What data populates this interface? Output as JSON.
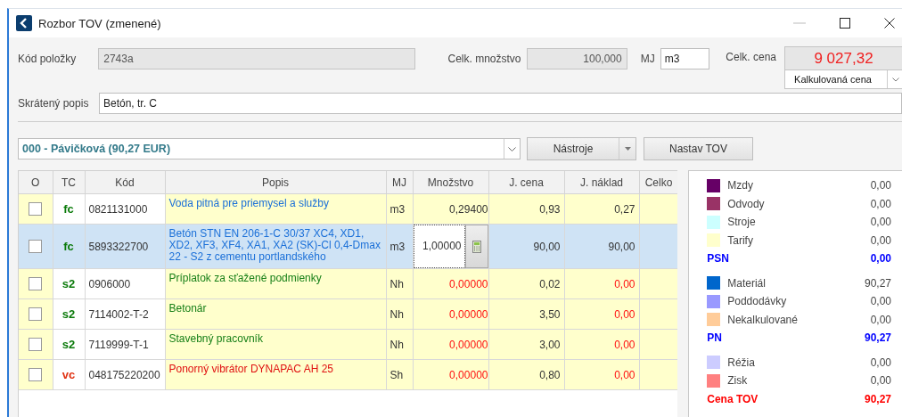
{
  "window": {
    "title": "Rozbor TOV (zmenené)"
  },
  "header": {
    "code_label": "Kód položky",
    "code_value": "2743a",
    "qty_label": "Celk. množstvo",
    "qty_value": "100,000",
    "unit_label": "MJ",
    "unit_value": "m3",
    "price_label": "Celk. cena",
    "price_value": "9 027,32",
    "price_type": "Kalkulovaná cena",
    "short_label": "Skrátený popis",
    "short_value": "Betón, tr. C"
  },
  "toolbar": {
    "combo": "000 - Pávičková (90,27 EUR)",
    "tools_button": "Nástroje",
    "set_button": "Nastav TOV"
  },
  "table": {
    "columns": [
      "O",
      "TC",
      "Kód",
      "Popis",
      "MJ",
      "Množstvo",
      "J. cena",
      "J. náklad",
      "Celko"
    ],
    "rows": [
      {
        "checked": false,
        "selected": false,
        "editing": false,
        "kind": "fc",
        "code": "0821131000",
        "desc": "Voda pitná pre priemysel a služby",
        "unit": "m3",
        "qty": "0,29400",
        "qty_zero": false,
        "price": "0,93",
        "cost": "0,27"
      },
      {
        "checked": false,
        "selected": true,
        "editing": true,
        "kind": "fc",
        "code": "5893322700",
        "desc": "Betón STN EN 206-1-C 30/37 XC4, XD1, XD2, XF3, XF4, XA1, XA2 (SK)-Cl 0,4-Dmax 22 - S2 z cementu portlandského",
        "unit": "m3",
        "qty": "1,00000",
        "qty_zero": false,
        "price": "90,00",
        "cost": "90,00"
      },
      {
        "checked": false,
        "selected": false,
        "editing": false,
        "kind": "s2",
        "code": "0906000",
        "desc": "Príplatok za sťažené podmienky",
        "unit": "Nh",
        "qty": "0,00000",
        "qty_zero": true,
        "price": "0,02",
        "cost": "0,00"
      },
      {
        "checked": false,
        "selected": false,
        "editing": false,
        "kind": "s2",
        "code": "7114002-T-2",
        "desc": "Betonár",
        "unit": "Nh",
        "qty": "0,00000",
        "qty_zero": true,
        "price": "3,50",
        "cost": "0,00"
      },
      {
        "checked": false,
        "selected": false,
        "editing": false,
        "kind": "s2",
        "code": "7119999-T-1",
        "desc": "Stavebný pracovník",
        "unit": "Nh",
        "qty": "0,00000",
        "qty_zero": true,
        "price": "3,00",
        "cost": "0,00"
      },
      {
        "checked": false,
        "selected": false,
        "editing": false,
        "kind": "vc",
        "code": "048175220200",
        "desc": "Ponorný vibrátor DYNAPAC AH 25",
        "unit": "Sh",
        "qty": "0,00000",
        "qty_zero": true,
        "price": "0,80",
        "cost": "0,00"
      }
    ]
  },
  "summary": [
    {
      "items": [
        {
          "label": "Mzdy",
          "value": "0,00",
          "color": "#660066"
        },
        {
          "label": "Odvody",
          "value": "0,00",
          "color": "#993366"
        },
        {
          "label": "Stroje",
          "value": "0,00",
          "color": "#ccffff"
        },
        {
          "label": "Tarify",
          "value": "0,00",
          "color": "#ffffcc"
        }
      ],
      "total": {
        "label": "PSN",
        "value": "0,00",
        "color": "#0000ff"
      }
    },
    {
      "items": [
        {
          "label": "Materiál",
          "value": "90,27",
          "color": "#0066cc"
        },
        {
          "label": "Poddodávky",
          "value": "0,00",
          "color": "#9999ff"
        },
        {
          "label": "Nekalkulované",
          "value": "0,00",
          "color": "#ffcc99"
        }
      ],
      "total": {
        "label": "PN",
        "value": "90,27",
        "color": "#0000ff"
      }
    },
    {
      "items": [
        {
          "label": "Réžia",
          "value": "0,00",
          "color": "#ccccff"
        },
        {
          "label": "Zisk",
          "value": "0,00",
          "color": "#ff8080"
        }
      ],
      "total": {
        "label": "Cena TOV",
        "value": "90,27",
        "color": "#ff0000"
      }
    }
  ]
}
